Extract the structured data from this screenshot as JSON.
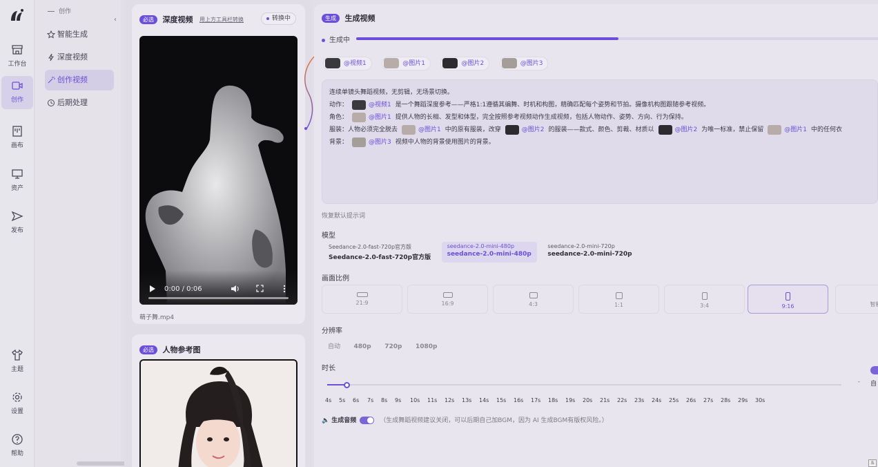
{
  "nav": {
    "items": [
      {
        "id": "workbench",
        "label": "工作台",
        "icon": "storefront-icon"
      },
      {
        "id": "create",
        "label": "创作",
        "icon": "video-camera-icon",
        "active": true
      },
      {
        "id": "canvas",
        "label": "画布",
        "icon": "board-icon"
      },
      {
        "id": "assets",
        "label": "资产",
        "icon": "monitor-icon"
      },
      {
        "id": "publish",
        "label": "发布",
        "icon": "send-icon"
      },
      {
        "id": "theme",
        "label": "主题",
        "icon": "tshirt-icon"
      },
      {
        "id": "settings",
        "label": "设置",
        "icon": "gear-icon"
      },
      {
        "id": "help",
        "label": "帮助",
        "icon": "help-circle-icon"
      }
    ]
  },
  "subnav": {
    "group": "创作",
    "items": [
      {
        "label": "智能生成",
        "icon": "star-icon"
      },
      {
        "label": "深度视频",
        "icon": "bolt-icon"
      },
      {
        "label": "创作视频",
        "icon": "wand-icon",
        "active": true
      },
      {
        "label": "后期处理",
        "icon": "clock-icon"
      }
    ]
  },
  "depth_card": {
    "tag": "必选",
    "title": "深度视频",
    "link": "用上方工具栏转换",
    "status": "转换中",
    "video_time": "0:00 / 0:06",
    "filename": "萌子舞.mp4"
  },
  "person_card": {
    "tag": "必选",
    "title": "人物参考图"
  },
  "generate": {
    "tag": "生成",
    "title": "生成视频",
    "progress_label": "生成中",
    "progress": 0.5,
    "refs": [
      {
        "label": "@视频1",
        "thumb": "#3a3a3e"
      },
      {
        "label": "@图片1",
        "thumb": "#b8aca8"
      },
      {
        "label": "@图片2",
        "thumb": "#2d2b30"
      },
      {
        "label": "@图片3",
        "thumb": "#a59e98"
      }
    ],
    "prompt": {
      "line1": "连续单镜头舞蹈视频，无剪辑，无场景切换。",
      "l2_a": "动作：",
      "l2_ref": "@视频1",
      "l2_b": "是一个舞蹈深度参考——严格1:1遵循其编舞、时机和构图，精确匹配每个姿势和节拍。摄像机构图跟随参考视频。",
      "l3_a": "角色：",
      "l3_ref": "@图片1",
      "l3_b": "提供人物的长相、发型和体型，完全按照参考视频动作生成视频，包括人物动作、姿势、方向、行为保持。",
      "l4_a": "服装：人物必须完全脱去",
      "l4_ref1": "@图片1",
      "l4_b": "中的原有服装，改穿",
      "l4_ref2": "@图片2",
      "l4_c": "的服装——款式、颜色、剪裁、材质以",
      "l4_ref3": "@图片2",
      "l4_d": "为唯一标准，禁止保留",
      "l4_ref4": "@图片1",
      "l4_e": "中的任何衣",
      "l5_a": "背景：",
      "l5_ref": "@图片3",
      "l5_b": "视频中人物的背景使用图片的背景。"
    },
    "reset": "恢复默认提示词",
    "model_label": "模型",
    "models": [
      {
        "small": "Seedance-2.0-fast-720p官方版",
        "big": "Seedance-2.0-fast-720p官方版"
      },
      {
        "small": "seedance-2.0-mini-480p",
        "big": "seedance-2.0-mini-480p",
        "active": true
      },
      {
        "small": "seedance-2.0-mini-720p",
        "big": "seedance-2.0-mini-720p"
      }
    ],
    "ratio_label": "画面比例",
    "ratios": [
      "21:9",
      "16:9",
      "4:3",
      "1:1",
      "3:4",
      "9:16",
      "智能"
    ],
    "ratio_active": "9:16",
    "res_label": "分辨率",
    "resolutions": [
      "自动",
      "480p",
      "720p",
      "1080p"
    ],
    "duration_label": "时长",
    "duration_ticks": [
      "4s",
      "5s",
      "6s",
      "7s",
      "8s",
      "9s",
      "10s",
      "11s",
      "12s",
      "13s",
      "14s",
      "15s",
      "16s",
      "17s",
      "18s",
      "19s",
      "20s",
      "21s",
      "22s",
      "23s",
      "24s",
      "25s",
      "26s",
      "27s",
      "28s",
      "29s",
      "30s"
    ],
    "duration_value": "4s",
    "duration_side": "自",
    "audio_label": "生成音频",
    "audio_on": true,
    "audio_hint": "（生成舞蹈视频建议关闭，可以后期自己加BGM，因为 AI 生成BGM有版权风险。）"
  }
}
